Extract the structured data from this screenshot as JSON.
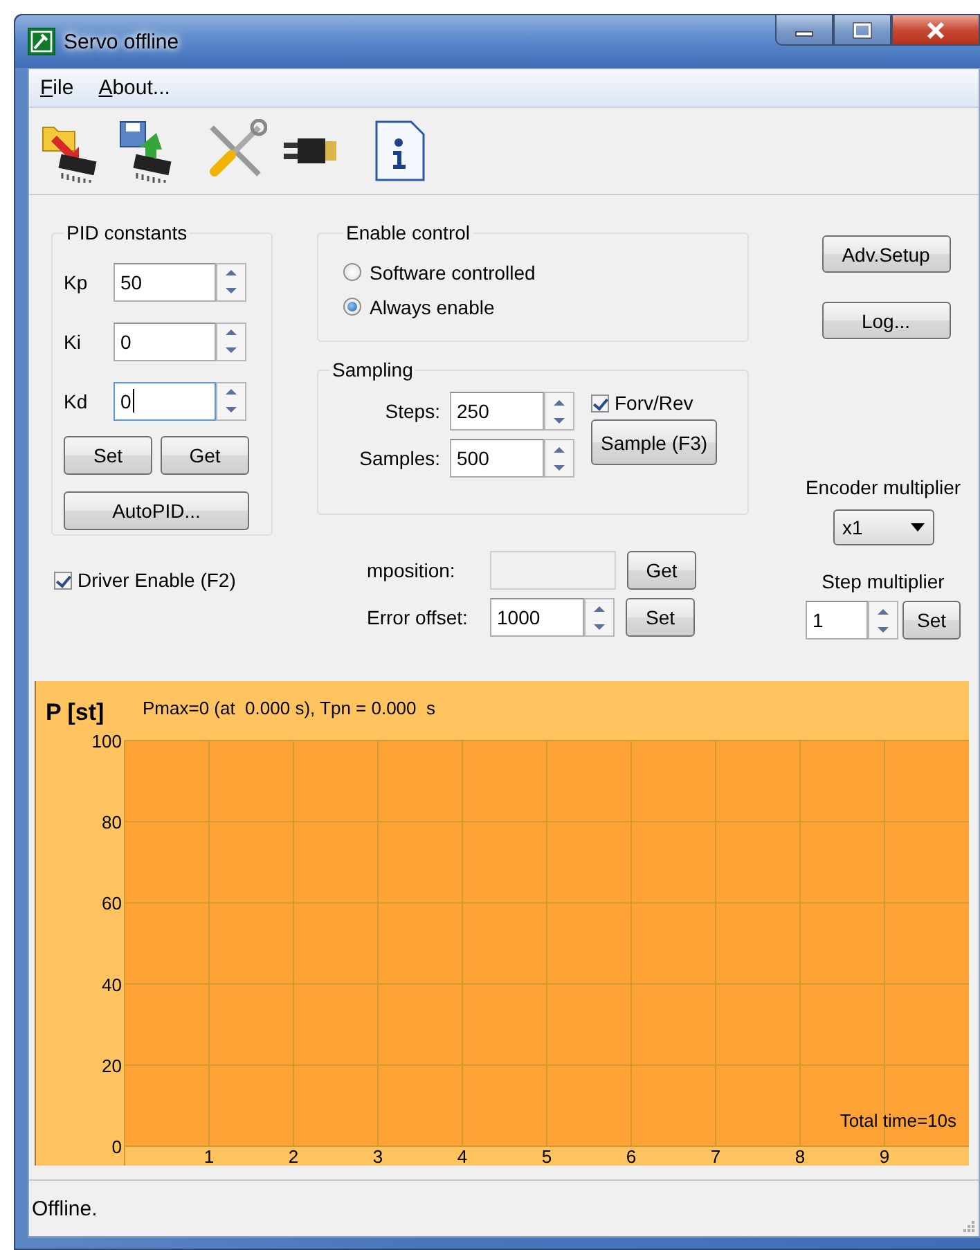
{
  "window": {
    "title": "Servo offline"
  },
  "menu": [
    {
      "label": "File"
    },
    {
      "label": "About..."
    }
  ],
  "pid_constants": {
    "title": "PID constants",
    "fields": [
      {
        "label": "Kp",
        "value": "50",
        "focused": false
      },
      {
        "label": "Ki",
        "value": "0",
        "focused": false
      },
      {
        "label": "Kd",
        "value": "0",
        "focused": true
      }
    ],
    "buttons": [
      "Set",
      "Get"
    ],
    "autopid_button": "AutoPID..."
  },
  "driver_enable": {
    "label": "Driver Enable (F2)",
    "checked": true
  },
  "enable_control": {
    "title": "Enable control",
    "options": [
      {
        "label": "Software controlled",
        "selected": false
      },
      {
        "label": "Always enable",
        "selected": true
      }
    ]
  },
  "sampling": {
    "title": "Sampling",
    "fields": [
      {
        "label": "Steps:",
        "value": "250"
      },
      {
        "label": "Samples:",
        "value": "500"
      }
    ],
    "checkbox": {
      "label": "Forv/Rev",
      "checked": true
    },
    "button": "Sample (F3)"
  },
  "mposition": {
    "label": "mposition:",
    "disabled": true,
    "button": "Get"
  },
  "error_offset": {
    "label": "Error offset:",
    "value": "1000",
    "button": "Set"
  },
  "side_buttons": [
    "Adv.Setup",
    "Log..."
  ],
  "encoder_multiplier": {
    "label": "Encoder multiplier",
    "value": "x1"
  },
  "step_multiplier": {
    "label": "Step multiplier",
    "value": "1",
    "button": "Set"
  },
  "chart": {
    "chart_data": {
      "type": "line",
      "title": "Pmax=0 (at  0.000 s), Tpn = 0.000  s",
      "ylabel": "P [st]",
      "xlim": [
        0,
        10
      ],
      "ylim": [
        0,
        100
      ],
      "xticks": [
        1,
        2,
        3,
        4,
        5,
        6,
        7,
        8,
        9
      ],
      "yticks": [
        0,
        20,
        40,
        60,
        80,
        100
      ],
      "annotations": [
        "Total time=10s"
      ],
      "grid": true
    }
  },
  "status_bar": {
    "text": "Offline."
  }
}
